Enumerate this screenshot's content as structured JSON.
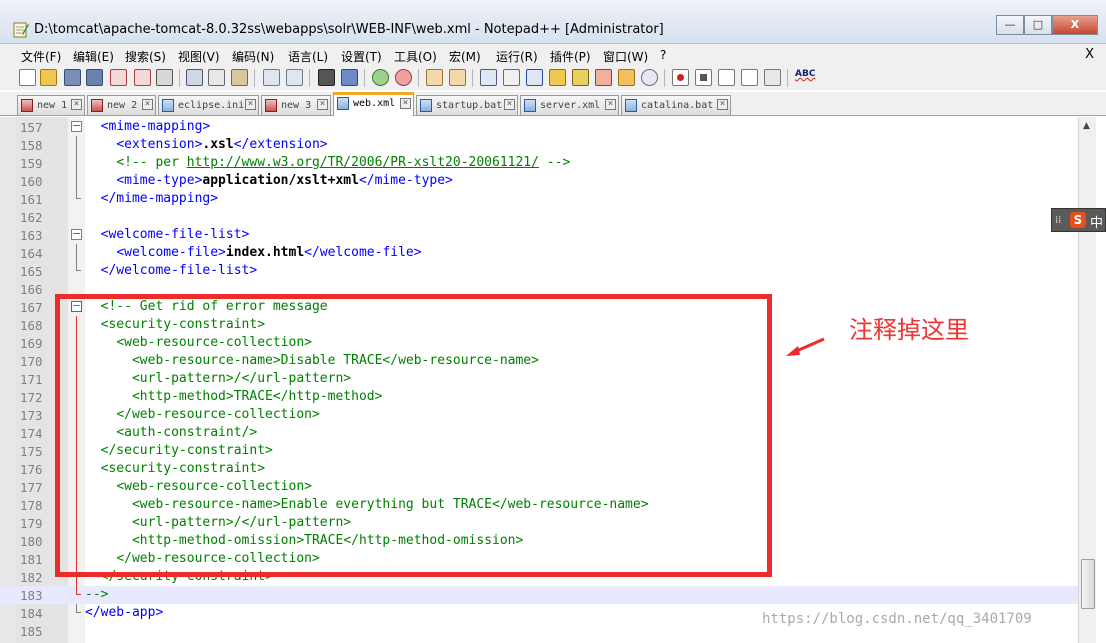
{
  "window": {
    "title": "D:\\tomcat\\apache-tomcat-8.0.32ss\\webapps\\solr\\WEB-INF\\web.xml - Notepad++ [Administrator]",
    "controls": {
      "minimize": "—",
      "maximize": "□",
      "close": "X"
    }
  },
  "menu": {
    "items": [
      "文件(F)",
      "编辑(E)",
      "搜索(S)",
      "视图(V)",
      "编码(N)",
      "语言(L)",
      "设置(T)",
      "工具(O)",
      "宏(M)",
      "运行(R)",
      "插件(P)",
      "窗口(W)",
      "?"
    ],
    "close_doc": "X"
  },
  "toolbar": {
    "icons": [
      "new-file-icon",
      "open-file-icon",
      "save-icon",
      "save-all-icon",
      "close-icon",
      "close-all-icon",
      "print-icon",
      "cut-icon",
      "copy-icon",
      "paste-icon",
      "undo-icon",
      "redo-icon",
      "find-icon",
      "replace-icon",
      "zoom-in-icon",
      "zoom-out-icon",
      "sync-vertical-icon",
      "sync-horizontal-icon",
      "word-wrap-icon",
      "show-all-chars-icon",
      "indent-guide-icon",
      "udl-icon",
      "doc-map-icon",
      "function-list-icon",
      "folder-workspace-icon",
      "monitoring-icon",
      "record-macro-icon",
      "stop-record-icon",
      "play-macro-icon",
      "run-macro-multiple-icon",
      "save-macro-icon",
      "spell-check-icon"
    ],
    "spell_label": "ABC"
  },
  "tabs": [
    {
      "label": "new 1",
      "icon": "red",
      "active": false
    },
    {
      "label": "new 2",
      "icon": "red",
      "active": false
    },
    {
      "label": "eclipse.ini",
      "icon": "blue",
      "active": false
    },
    {
      "label": "new 3",
      "icon": "red",
      "active": false
    },
    {
      "label": "web.xml",
      "icon": "blue",
      "active": true
    },
    {
      "label": "startup.bat",
      "icon": "blue",
      "active": false
    },
    {
      "label": "server.xml",
      "icon": "blue",
      "active": false
    },
    {
      "label": "catalina.bat",
      "icon": "blue",
      "active": false
    }
  ],
  "editor": {
    "lines": [
      {
        "n": "157",
        "fold": "open",
        "indent": "  ",
        "tokens": [
          [
            "tag",
            "<mime-mapping>"
          ]
        ]
      },
      {
        "n": "158",
        "fold": "line",
        "indent": "    ",
        "tokens": [
          [
            "tag",
            "<extension>"
          ],
          [
            "txt",
            ".xsl"
          ],
          [
            "tag",
            "</extension>"
          ]
        ]
      },
      {
        "n": "159",
        "fold": "line",
        "indent": "    ",
        "tokens": [
          [
            "cmt",
            "<!-- per "
          ],
          [
            "url",
            "http://www.w3.org/TR/2006/PR-xslt20-20061121/"
          ],
          [
            "cmt",
            " -->"
          ]
        ]
      },
      {
        "n": "160",
        "fold": "line",
        "indent": "    ",
        "tokens": [
          [
            "tag",
            "<mime-type>"
          ],
          [
            "txt",
            "application/xslt+xml"
          ],
          [
            "tag",
            "</mime-type>"
          ]
        ]
      },
      {
        "n": "161",
        "fold": "end",
        "indent": "  ",
        "tokens": [
          [
            "tag",
            "</mime-mapping>"
          ]
        ]
      },
      {
        "n": "162",
        "fold": "none",
        "indent": "",
        "tokens": []
      },
      {
        "n": "163",
        "fold": "open",
        "indent": "  ",
        "tokens": [
          [
            "tag",
            "<welcome-file-list>"
          ]
        ]
      },
      {
        "n": "164",
        "fold": "line",
        "indent": "    ",
        "tokens": [
          [
            "tag",
            "<welcome-file>"
          ],
          [
            "txt",
            "index.html"
          ],
          [
            "tag",
            "</welcome-file>"
          ]
        ]
      },
      {
        "n": "165",
        "fold": "end",
        "indent": "  ",
        "tokens": [
          [
            "tag",
            "</welcome-file-list>"
          ]
        ]
      },
      {
        "n": "166",
        "fold": "none",
        "indent": "",
        "tokens": []
      },
      {
        "n": "167",
        "fold": "open-red",
        "indent": "  ",
        "tokens": [
          [
            "cmt",
            "<!-- Get rid of error message"
          ]
        ]
      },
      {
        "n": "168",
        "fold": "line-red",
        "indent": "  ",
        "tokens": [
          [
            "cmt",
            "<security-constraint>"
          ]
        ]
      },
      {
        "n": "169",
        "fold": "line-red",
        "indent": "    ",
        "tokens": [
          [
            "cmt",
            "<web-resource-collection>"
          ]
        ]
      },
      {
        "n": "170",
        "fold": "line-red",
        "indent": "      ",
        "tokens": [
          [
            "cmt",
            "<web-resource-name>Disable TRACE</web-resource-name>"
          ]
        ]
      },
      {
        "n": "171",
        "fold": "line-red",
        "indent": "      ",
        "tokens": [
          [
            "cmt",
            "<url-pattern>/</url-pattern>"
          ]
        ]
      },
      {
        "n": "172",
        "fold": "line-red",
        "indent": "      ",
        "tokens": [
          [
            "cmt",
            "<http-method>TRACE</http-method>"
          ]
        ]
      },
      {
        "n": "173",
        "fold": "line-red",
        "indent": "    ",
        "tokens": [
          [
            "cmt",
            "</web-resource-collection>"
          ]
        ]
      },
      {
        "n": "174",
        "fold": "line-red",
        "indent": "    ",
        "tokens": [
          [
            "cmt",
            "<auth-constraint/>"
          ]
        ]
      },
      {
        "n": "175",
        "fold": "line-red",
        "indent": "  ",
        "tokens": [
          [
            "cmt",
            "</security-constraint>"
          ]
        ]
      },
      {
        "n": "176",
        "fold": "line-red",
        "indent": "  ",
        "tokens": [
          [
            "cmt",
            "<security-constraint>"
          ]
        ]
      },
      {
        "n": "177",
        "fold": "line-red",
        "indent": "    ",
        "tokens": [
          [
            "cmt",
            "<web-resource-collection>"
          ]
        ]
      },
      {
        "n": "178",
        "fold": "line-red",
        "indent": "      ",
        "tokens": [
          [
            "cmt",
            "<web-resource-name>Enable everything but TRACE</web-resource-name>"
          ]
        ]
      },
      {
        "n": "179",
        "fold": "line-red",
        "indent": "      ",
        "tokens": [
          [
            "cmt",
            "<url-pattern>/</url-pattern>"
          ]
        ]
      },
      {
        "n": "180",
        "fold": "line-red",
        "indent": "      ",
        "tokens": [
          [
            "cmt",
            "<http-method-omission>TRACE</http-method-omission>"
          ]
        ]
      },
      {
        "n": "181",
        "fold": "line-red",
        "indent": "    ",
        "tokens": [
          [
            "cmt",
            "</web-resource-collection>"
          ]
        ]
      },
      {
        "n": "182",
        "fold": "line-red",
        "indent": "  ",
        "tokens": [
          [
            "cmt",
            "</security-constraint>"
          ]
        ]
      },
      {
        "n": "183",
        "fold": "end-red",
        "indent": "",
        "tokens": [
          [
            "cmt",
            "-->"
          ]
        ],
        "current": true
      },
      {
        "n": "184",
        "fold": "end",
        "indent": "",
        "tokens": [
          [
            "tag",
            "</web-app>"
          ]
        ]
      },
      {
        "n": "185",
        "fold": "none",
        "indent": "",
        "tokens": []
      }
    ]
  },
  "ime": {
    "lang": "中",
    "logo": "S"
  },
  "annotation": {
    "text": "注释掉这里",
    "color": "#ee2b2b"
  },
  "watermark": "https://blog.csdn.net/qq_3401709",
  "colors": {
    "tag": "#0000ff",
    "comment": "#008000",
    "text": "#000000",
    "tab_accent": "#f5a623"
  }
}
